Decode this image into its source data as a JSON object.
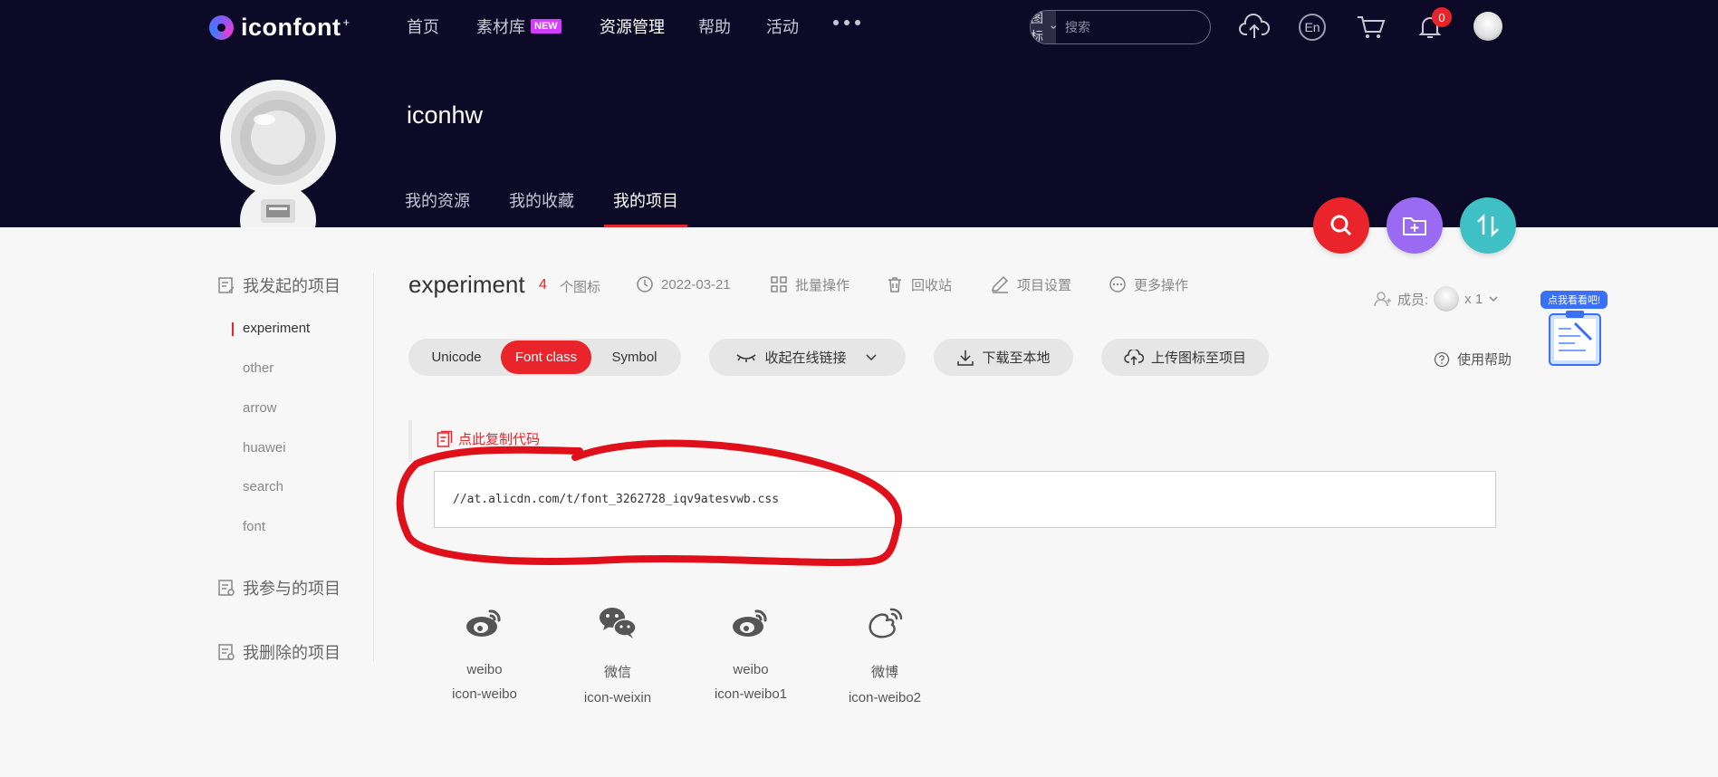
{
  "brand": {
    "name": "iconfont",
    "sup": "+"
  },
  "nav": {
    "items": [
      {
        "label": "首页",
        "badge": ""
      },
      {
        "label": "素材库",
        "badge": "NEW"
      },
      {
        "label": "资源管理",
        "badge": ""
      },
      {
        "label": "帮助",
        "badge": ""
      },
      {
        "label": "活动",
        "badge": ""
      }
    ],
    "more_icon": "more-dots-icon",
    "search": {
      "type_label": "图标",
      "placeholder": "搜索"
    },
    "lang_label": "En",
    "notification_count": "0",
    "icons": [
      "upload-cloud-icon",
      "language-icon",
      "cart-icon",
      "bell-icon",
      "user-avatar"
    ]
  },
  "profile": {
    "username": "iconhw",
    "tabs": [
      {
        "label": "我的资源"
      },
      {
        "label": "我的收藏"
      },
      {
        "label": "我的项目"
      }
    ]
  },
  "fabs": [
    {
      "icon": "search-icon",
      "color": "#e9242a"
    },
    {
      "icon": "folder-add-icon",
      "color": "#9a6bf2"
    },
    {
      "icon": "sort-icon",
      "color": "#3fc0c4"
    }
  ],
  "sidebar": {
    "groups": [
      {
        "label": "我发起的项目"
      },
      {
        "label": "我参与的项目"
      },
      {
        "label": "我删除的项目"
      }
    ],
    "projects": [
      {
        "label": "experiment"
      },
      {
        "label": "other"
      },
      {
        "label": "arrow"
      },
      {
        "label": "huawei"
      },
      {
        "label": "search"
      },
      {
        "label": "font"
      }
    ]
  },
  "project": {
    "title": "experiment",
    "icon_count": "4",
    "icon_count_label": "个图标",
    "date": "2022-03-21",
    "actions": [
      {
        "label": "批量操作"
      },
      {
        "label": "回收站"
      },
      {
        "label": "项目设置"
      },
      {
        "label": "更多操作"
      }
    ],
    "members_label": "成员:",
    "members_count": "x 1"
  },
  "toolbar": {
    "modes": [
      {
        "label": "Unicode"
      },
      {
        "label": "Font class"
      },
      {
        "label": "Symbol"
      }
    ],
    "collapse_link_label": "收起在线链接",
    "download_label": "下载至本地",
    "upload_label": "上传图标至项目",
    "help_label": "使用帮助"
  },
  "assistant": {
    "bubble": "点我看看吧!"
  },
  "code": {
    "copy_label": "点此复制代码",
    "url": "//at.alicdn.com/t/font_3262728_iqv9atesvwb.css"
  },
  "icons": [
    {
      "name": "weibo",
      "code": "icon-weibo",
      "glyph": "weibo-icon"
    },
    {
      "name": "微信",
      "code": "icon-weixin",
      "glyph": "wechat-icon"
    },
    {
      "name": "weibo",
      "code": "icon-weibo1",
      "glyph": "weibo-icon"
    },
    {
      "name": "微博",
      "code": "icon-weibo2",
      "glyph": "weibo-outline-icon"
    }
  ],
  "colors": {
    "header_bg": "#0c0a26",
    "accent": "#e9242a",
    "page_bg": "#f7f7f7",
    "annotation_stroke": "#e0101a"
  }
}
